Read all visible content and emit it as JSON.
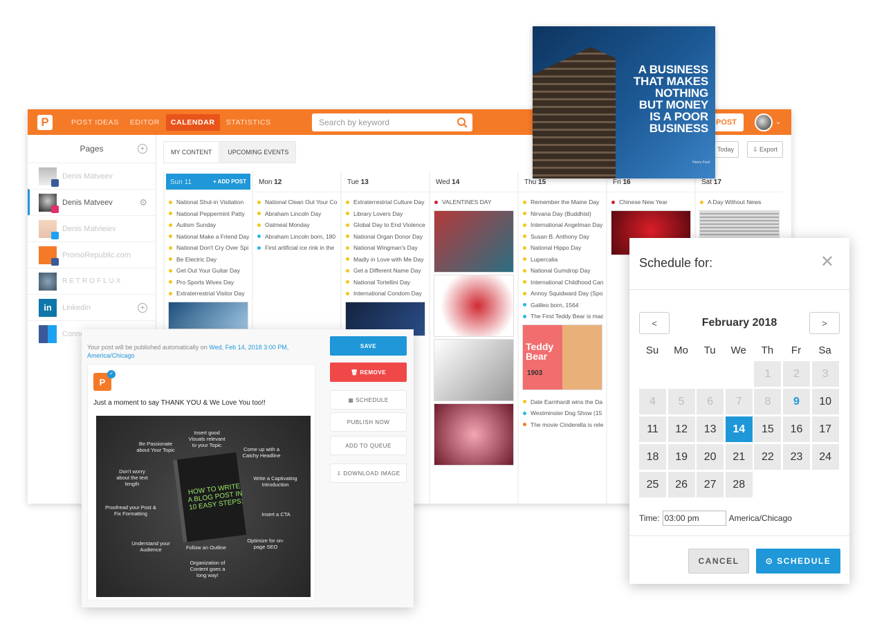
{
  "app": {
    "logo_letter": "P",
    "nav": [
      "POST IDEAS",
      "EDITOR",
      "CALENDAR",
      "STATISTICS"
    ],
    "search_placeholder": "Search by keyword",
    "post_button": "POST",
    "colors": {
      "brand": "#f57a28",
      "accent": "#1f97d8",
      "danger": "#f04848"
    }
  },
  "sidebar": {
    "title": "Pages",
    "items": [
      {
        "label": "Denis Matveev",
        "badge": "facebook"
      },
      {
        "label": "Denis Matveev",
        "badge": "instagram",
        "active": true
      },
      {
        "label": "Denis Matvieiev",
        "badge": "twitter"
      },
      {
        "label": "PromoRepublic.com",
        "badge": "facebook"
      },
      {
        "label": "RETROFLUX",
        "badge": ""
      },
      {
        "label": "Linkedin",
        "badge": "linkedin"
      },
      {
        "label": "Conne",
        "badge": "multi"
      }
    ]
  },
  "tabs": [
    "MY CONTENT",
    "UPCOMING EVENTS"
  ],
  "toolbar": {
    "today": "Today",
    "export": "Export"
  },
  "calendar": {
    "add_post": "+ ADD POST",
    "columns": [
      {
        "day": "Sun",
        "date": "11",
        "today": true,
        "events": [
          {
            "t": "National Shut-in Visitation",
            "c": "#f5c518"
          },
          {
            "t": "National Peppermint Patty",
            "c": "#f5c518"
          },
          {
            "t": "Autism Sunday",
            "c": "#f5c518"
          },
          {
            "t": "National Make a Friend Day",
            "c": "#f5c518"
          },
          {
            "t": "National Don't Cry Over Spi",
            "c": "#f5c518"
          },
          {
            "t": "Be Electric Day",
            "c": "#f5c518"
          },
          {
            "t": "Get Out Your Guitar Day",
            "c": "#f5c518"
          },
          {
            "t": "Pro Sports Wives Day",
            "c": "#f5c518"
          },
          {
            "t": "Extraterrestrial Visitor Day",
            "c": "#f5c518"
          }
        ]
      },
      {
        "day": "Mon",
        "date": "12",
        "events": [
          {
            "t": "National Clean Out Your Co",
            "c": "#f5c518"
          },
          {
            "t": "Abraham Lincoln Day",
            "c": "#f5c518"
          },
          {
            "t": "Oatmeal Monday",
            "c": "#f5c518"
          },
          {
            "t": "Abraham Lincoln born, 180",
            "c": "#29b6e8"
          },
          {
            "t": "First artificial ice rink in the",
            "c": "#29b6e8"
          }
        ]
      },
      {
        "day": "Tue",
        "date": "13",
        "events": [
          {
            "t": "Extraterrestrial Culture Day",
            "c": "#f5c518"
          },
          {
            "t": "Library Lovers Day",
            "c": "#f5c518"
          },
          {
            "t": "Global Day to End Violence",
            "c": "#f5c518"
          },
          {
            "t": "National Organ Donor Day",
            "c": "#f5c518"
          },
          {
            "t": "National Wingman's Day",
            "c": "#f5c518"
          },
          {
            "t": "Madly in Love with Me Day",
            "c": "#f5c518"
          },
          {
            "t": "Get a Different Name Day",
            "c": "#f5c518"
          },
          {
            "t": "National Tortellini Day",
            "c": "#f5c518"
          },
          {
            "t": "International Condom Day",
            "c": "#f5c518"
          }
        ]
      },
      {
        "day": "Wed",
        "date": "14",
        "events": [
          {
            "t": "VALENTINES DAY",
            "c": "#d0202a"
          }
        ]
      },
      {
        "day": "Thu",
        "date": "15",
        "events": [
          {
            "t": "Remember the Maine Day",
            "c": "#f5c518"
          },
          {
            "t": "Nirvana Day (Buddhist)",
            "c": "#f5c518"
          },
          {
            "t": "International Angelman Day",
            "c": "#f5c518"
          },
          {
            "t": "Susan B. Anthony Day",
            "c": "#f5c518"
          },
          {
            "t": "National Hippo Day",
            "c": "#f5c518"
          },
          {
            "t": "Lupercalia",
            "c": "#f5c518"
          },
          {
            "t": "National Gumdrop Day",
            "c": "#f5c518"
          },
          {
            "t": "International Childhood Can",
            "c": "#f5c518"
          },
          {
            "t": "Annoy Squidward Day (Spo",
            "c": "#f5c518"
          },
          {
            "t": "Galileo born, 1564",
            "c": "#29b6e8"
          },
          {
            "t": "The First Teddy Bear is mad",
            "c": "#29b6e8"
          }
        ],
        "late_events": [
          {
            "t": "Dale Earnhardt wins the Da",
            "c": "#f5c518"
          },
          {
            "t": "Westminster Dog Show (15",
            "c": "#29b6e8"
          },
          {
            "t": "The movie Cinderella is rele",
            "c": "#f57a28"
          }
        ]
      },
      {
        "day": "Fri",
        "date": "16",
        "events": [
          {
            "t": "Chinese New Year",
            "c": "#d0202a"
          }
        ]
      },
      {
        "day": "Sat",
        "date": "17",
        "events": [
          {
            "t": "A Day Without News",
            "c": "#f5c518"
          }
        ]
      }
    ],
    "teddy": {
      "line1": "Teddy",
      "line2": "Bear",
      "year": "1903"
    }
  },
  "photo": {
    "quote": [
      "A BUSINESS",
      "THAT MAKES",
      "NOTHING",
      "BUT MONEY",
      "IS A POOR",
      "BUSINESS"
    ],
    "signature": "Henry Ford"
  },
  "editor": {
    "publish_prefix": "Your post will be published automatically on",
    "publish_date": "Wed, Feb 14, 2018 3:00 PM,",
    "publish_tz": "America/Chicago",
    "message": "Just a moment to say THANK YOU & We Love You too!!",
    "book_title": "HOW TO WRITE A BLOG POST IN 10 EASY STEPS:",
    "tips": [
      "Be Passionate about Your Topic",
      "Insert good Visuals relevant to your Topic",
      "Come up with a Catchy Headline",
      "Don't worry about the text length",
      "Write a Captivating Introduction",
      "Proofread your Post & Fix Formatting",
      "Insert a CTA",
      "Understand your Audience",
      "Follow an Outline",
      "Optimize for on-page SEO",
      "Organization of Content goes a long way!"
    ],
    "actions": {
      "save": "SAVE",
      "remove": "REMOVE",
      "schedule": "SCHEDULE",
      "publish": "PUBLISH NOW",
      "queue": "ADD TO QUEUE",
      "download": "DOWNLOAD IMAGE"
    }
  },
  "scheduler": {
    "title": "Schedule for:",
    "month": "February 2018",
    "prev": "<",
    "next": ">",
    "weekdays": [
      "Su",
      "Mo",
      "Tu",
      "We",
      "Th",
      "Fr",
      "Sa"
    ],
    "prev_month_days": [
      "1",
      "2",
      "3",
      "4",
      "5",
      "6",
      "7",
      "8"
    ],
    "days": [
      "9",
      "10",
      "11",
      "12",
      "13",
      "14",
      "15",
      "16",
      "17",
      "18",
      "19",
      "20",
      "21",
      "22",
      "23",
      "24",
      "25",
      "26",
      "27",
      "28"
    ],
    "highlight_day": "9",
    "selected_day": "14",
    "time_label": "Time:",
    "time_value": "03:00 pm",
    "timezone": "America/Chicago",
    "cancel": "CANCEL",
    "schedule": "SCHEDULE"
  }
}
